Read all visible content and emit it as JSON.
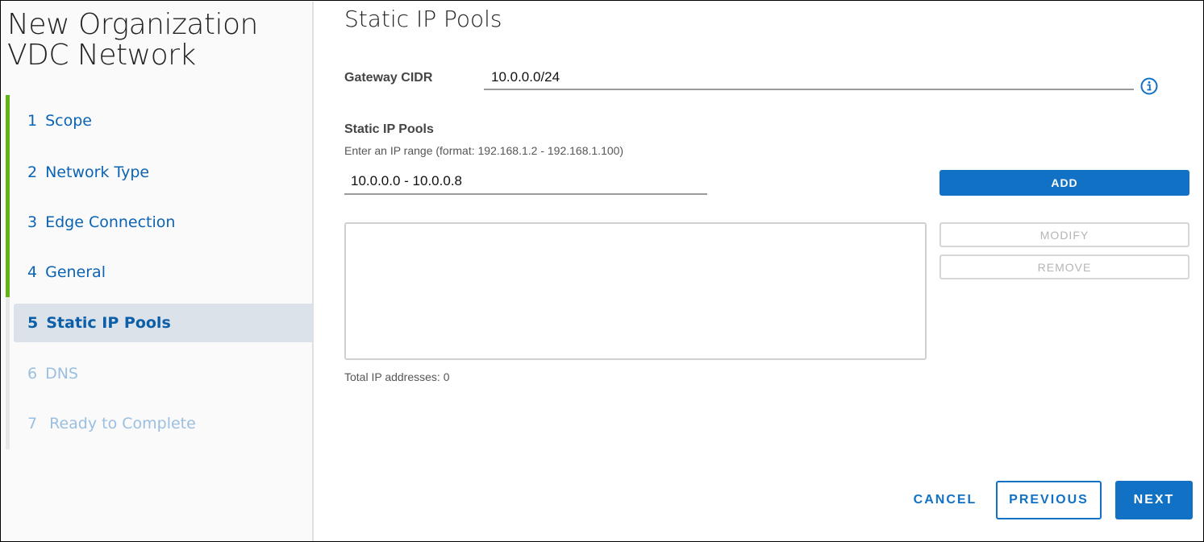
{
  "wizard": {
    "title_line1": "New Organization",
    "title_line2": "VDC Network",
    "steps": [
      {
        "num": "1",
        "label": "Scope",
        "state": "completed"
      },
      {
        "num": "2",
        "label": "Network Type",
        "state": "completed"
      },
      {
        "num": "3",
        "label": "Edge Connection",
        "state": "completed"
      },
      {
        "num": "4",
        "label": "General",
        "state": "completed"
      },
      {
        "num": "5",
        "label": "Static IP Pools",
        "state": "active"
      },
      {
        "num": "6",
        "label": "DNS",
        "state": "disabled"
      },
      {
        "num": "7",
        "label": "Ready to Complete",
        "state": "disabled"
      }
    ]
  },
  "page": {
    "title": "Static IP Pools",
    "gateway_cidr_label": "Gateway CIDR",
    "gateway_cidr_value": "10.0.0.0/24",
    "info_icon": "info-circle-icon",
    "pools_label": "Static IP Pools",
    "pools_hint": "Enter an IP range (format: 192.168.1.2 - 192.168.1.100)",
    "range_value": "10.0.0.0 - 10.0.0.8",
    "add_label": "ADD",
    "modify_label": "MODIFY",
    "remove_label": "REMOVE",
    "pool_list_items": [],
    "total_label": "Total IP addresses: 0"
  },
  "footer": {
    "cancel_label": "CANCEL",
    "previous_label": "PREVIOUS",
    "next_label": "NEXT"
  },
  "colors": {
    "accent": "#1171c4",
    "completed": "#60b515",
    "active_bg": "#dbe2ea"
  }
}
